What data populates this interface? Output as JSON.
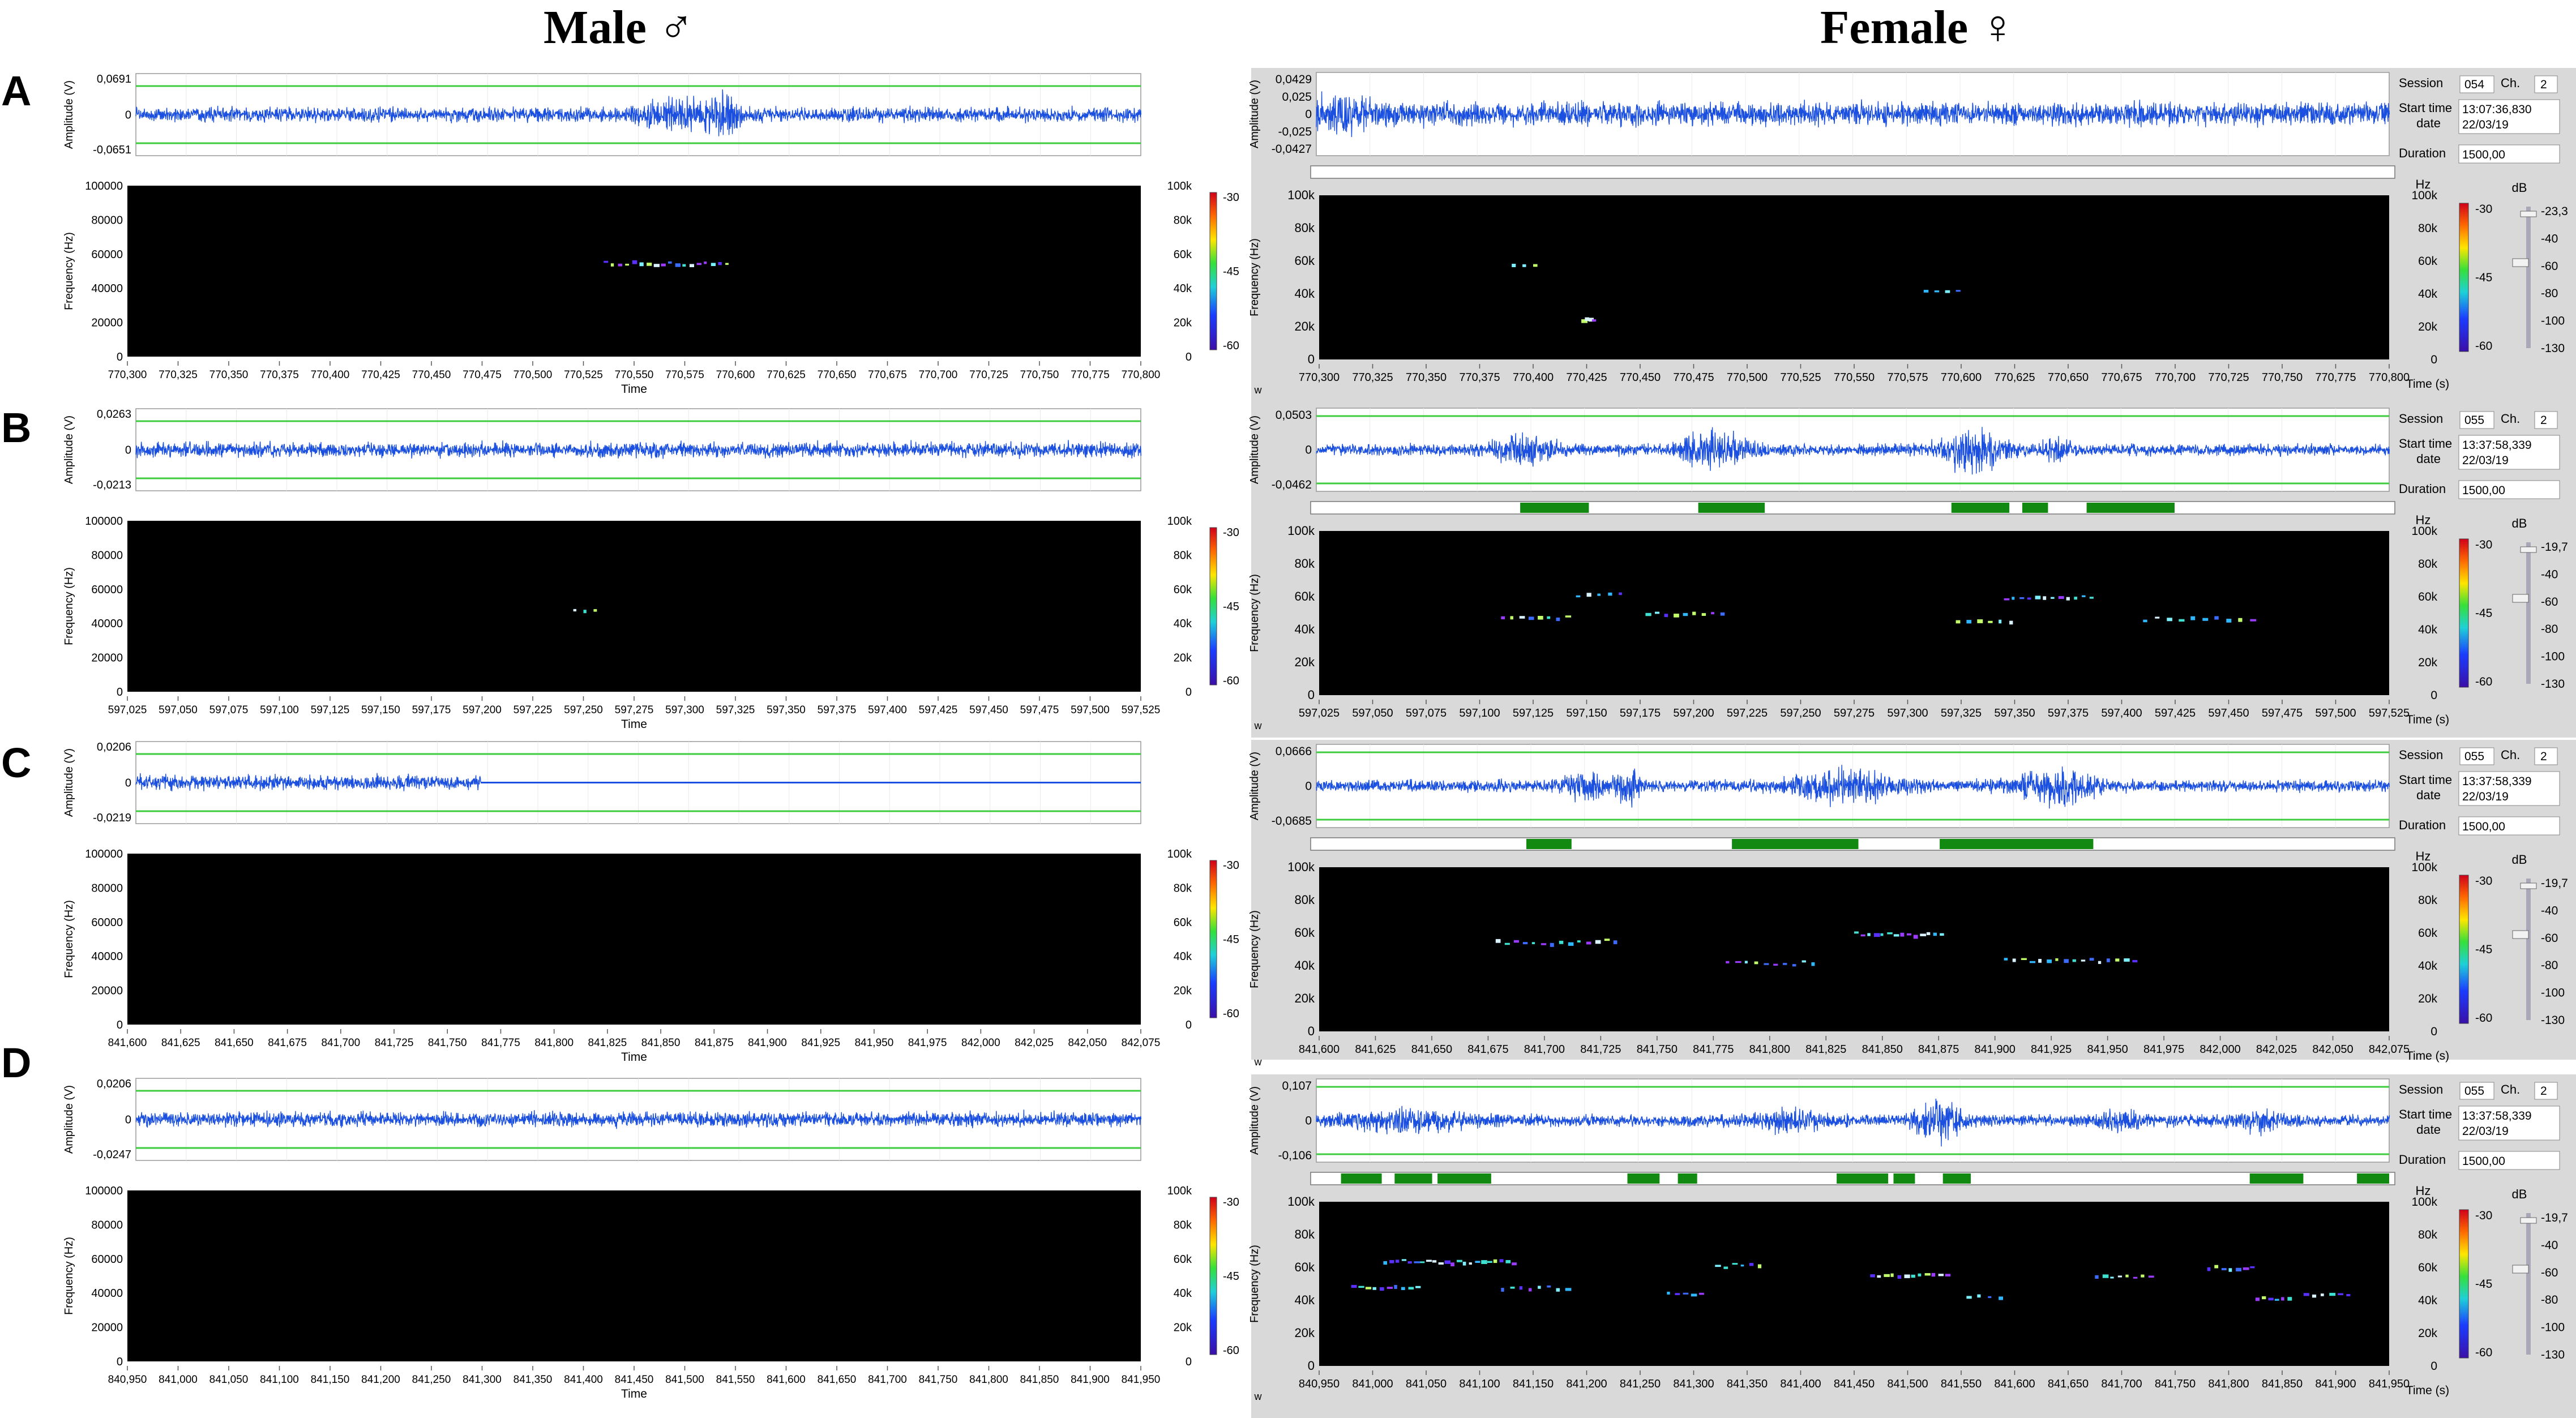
{
  "figure": {
    "col_titles": {
      "male": "Male ♂",
      "female": "Female ♀"
    }
  },
  "labels": {
    "amp_axis": "Amplitude (V)",
    "freq_axis": "Frequency (Hz)",
    "time_axis_male": "Time",
    "time_axis_female": "Time (s)",
    "session": "Session",
    "ch": "Ch.",
    "start_time": "Start time",
    "date": "date",
    "duration": "Duration",
    "hz": "Hz",
    "db": "dB",
    "w": "w"
  },
  "colors": {
    "waveform": "#1a4fe0",
    "threshold_line": "#3dcc3d",
    "detection_bar": "#128a12",
    "spectrogram_bg": "#000000",
    "panel_bg": "#d9d9d9"
  },
  "chart_data": [
    {
      "row": "A",
      "male": {
        "type": "waveform+spectrogram",
        "amp_ticks": [
          "0,0691",
          "0",
          "-0,0651"
        ],
        "freq_ticks": [
          "100000",
          "80000",
          "60000",
          "40000",
          "20000",
          "0"
        ],
        "cbar_freq_ticks": [
          "100k",
          "80k",
          "60k",
          "40k",
          "20k",
          "0"
        ],
        "cbar_db_ticks": [
          "-30",
          "-45",
          "-60"
        ],
        "time_ticks": [
          "770,300",
          "770,325",
          "770,350",
          "770,375",
          "770,400",
          "770,425",
          "770,450",
          "770,475",
          "770,500",
          "770,525",
          "770,550",
          "770,575",
          "770,600",
          "770,625",
          "770,650",
          "770,675",
          "770,700",
          "770,725",
          "770,750",
          "770,775",
          "770,800"
        ],
        "xlim": [
          770.3,
          770.8
        ]
      },
      "female": {
        "type": "waveform+spectrogram",
        "amp_ticks": [
          "0,0429",
          "0,025",
          "0",
          "-0,025",
          "-0,0427"
        ],
        "freq_ticks": [
          "100k",
          "80k",
          "60k",
          "40k",
          "20k",
          "0"
        ],
        "cbar_freq_ticks": [
          "100k",
          "80k",
          "60k",
          "40k",
          "20k",
          "0"
        ],
        "cbar_db_ticks": [
          "-30",
          "-45",
          "-60"
        ],
        "db_scale_ticks": [
          "-23,3",
          "-40",
          "-60",
          "-80",
          "-100",
          "-130"
        ],
        "time_ticks": [
          "770,300",
          "770,325",
          "770,350",
          "770,375",
          "770,400",
          "770,425",
          "770,450",
          "770,475",
          "770,500",
          "770,525",
          "770,550",
          "770,575",
          "770,600",
          "770,625",
          "770,650",
          "770,675",
          "770,700",
          "770,725",
          "770,750",
          "770,775",
          "770,800"
        ],
        "xlim": [
          770.3,
          770.8
        ],
        "session": "054",
        "channel": "2",
        "start_time": "13:07:36,830",
        "date": "22/03/19",
        "duration": "1500,00",
        "detections": []
      }
    },
    {
      "row": "B",
      "male": {
        "type": "waveform+spectrogram",
        "amp_ticks": [
          "0,0263",
          "0",
          "-0,0213"
        ],
        "freq_ticks": [
          "100000",
          "80000",
          "60000",
          "40000",
          "20000",
          "0"
        ],
        "cbar_freq_ticks": [
          "100k",
          "80k",
          "60k",
          "40k",
          "20k",
          "0"
        ],
        "cbar_db_ticks": [
          "-30",
          "-45",
          "-60"
        ],
        "time_ticks": [
          "597,025",
          "597,050",
          "597,075",
          "597,100",
          "597,125",
          "597,150",
          "597,175",
          "597,200",
          "597,225",
          "597,250",
          "597,275",
          "597,300",
          "597,325",
          "597,350",
          "597,375",
          "597,400",
          "597,425",
          "597,450",
          "597,475",
          "597,500",
          "597,525"
        ],
        "xlim": [
          597.025,
          597.525
        ]
      },
      "female": {
        "type": "waveform+spectrogram",
        "amp_ticks": [
          "0,0503",
          "0",
          "-0,0462"
        ],
        "freq_ticks": [
          "100k",
          "80k",
          "60k",
          "40k",
          "20k",
          "0"
        ],
        "cbar_freq_ticks": [
          "100k",
          "80k",
          "60k",
          "40k",
          "20k",
          "0"
        ],
        "cbar_db_ticks": [
          "-30",
          "-45",
          "-60"
        ],
        "db_scale_ticks": [
          "-19,7",
          "-40",
          "-60",
          "-80",
          "-100",
          "-130"
        ],
        "time_ticks": [
          "597,025",
          "597,050",
          "597,075",
          "597,100",
          "597,125",
          "597,150",
          "597,175",
          "597,200",
          "597,225",
          "597,250",
          "597,275",
          "597,300",
          "597,325",
          "597,350",
          "597,375",
          "597,400",
          "597,425",
          "597,450",
          "597,475",
          "597,500",
          "597,525"
        ],
        "xlim": [
          597.025,
          597.525
        ],
        "session": "055",
        "channel": "2",
        "start_time": "13:37:58,339",
        "date": "22/03/19",
        "duration": "1500,00",
        "detections": [
          [
            597.12,
            597.152
          ],
          [
            597.203,
            597.234
          ],
          [
            597.321,
            597.348
          ],
          [
            597.354,
            597.366
          ],
          [
            597.384,
            597.425
          ]
        ]
      }
    },
    {
      "row": "C",
      "male": {
        "type": "waveform+spectrogram",
        "amp_ticks": [
          "0,0206",
          "0",
          "-0,0219"
        ],
        "freq_ticks": [
          "100000",
          "80000",
          "60000",
          "40000",
          "20000",
          "0"
        ],
        "cbar_freq_ticks": [
          "100k",
          "80k",
          "60k",
          "40k",
          "20k",
          "0"
        ],
        "cbar_db_ticks": [
          "-30",
          "-45",
          "-60"
        ],
        "time_ticks": [
          "841,600",
          "841,625",
          "841,650",
          "841,675",
          "841,700",
          "841,725",
          "841,750",
          "841,775",
          "841,800",
          "841,825",
          "841,850",
          "841,875",
          "841,900",
          "841,925",
          "841,950",
          "841,975",
          "842,000",
          "842,025",
          "842,050",
          "842,075"
        ],
        "xlim": [
          841.6,
          842.075
        ],
        "signal_end": 841.763
      },
      "female": {
        "type": "waveform+spectrogram",
        "amp_ticks": [
          "0,0666",
          "0",
          "-0,0685"
        ],
        "freq_ticks": [
          "100k",
          "80k",
          "60k",
          "40k",
          "20k",
          "0"
        ],
        "cbar_freq_ticks": [
          "100k",
          "80k",
          "60k",
          "40k",
          "20k",
          "0"
        ],
        "cbar_db_ticks": [
          "-30",
          "-45",
          "-60"
        ],
        "db_scale_ticks": [
          "-19,7",
          "-40",
          "-60",
          "-80",
          "-100",
          "-130"
        ],
        "time_ticks": [
          "841,600",
          "841,625",
          "841,650",
          "841,675",
          "841,700",
          "841,725",
          "841,750",
          "841,775",
          "841,800",
          "841,825",
          "841,850",
          "841,875",
          "841,900",
          "841,925",
          "841,950",
          "841,975",
          "842,000",
          "842,025",
          "842,050",
          "842,075"
        ],
        "xlim": [
          841.6,
          842.075
        ],
        "session": "055",
        "channel": "2",
        "start_time": "13:37:58,339",
        "date": "22/03/19",
        "duration": "1500,00",
        "detections": [
          [
            841.693,
            841.713
          ],
          [
            841.784,
            841.84
          ],
          [
            841.876,
            841.944
          ]
        ]
      }
    },
    {
      "row": "D",
      "male": {
        "type": "waveform+spectrogram",
        "amp_ticks": [
          "0,0206",
          "0",
          "-0,0247"
        ],
        "freq_ticks": [
          "100000",
          "80000",
          "60000",
          "40000",
          "20000",
          "0"
        ],
        "cbar_freq_ticks": [
          "100k",
          "80k",
          "60k",
          "40k",
          "20k",
          "0"
        ],
        "cbar_db_ticks": [
          "-30",
          "-45",
          "-60"
        ],
        "time_ticks": [
          "840,950",
          "841,000",
          "841,050",
          "841,100",
          "841,150",
          "841,200",
          "841,250",
          "841,300",
          "841,350",
          "841,400",
          "841,450",
          "841,500",
          "841,550",
          "841,600",
          "841,650",
          "841,700",
          "841,750",
          "841,800",
          "841,850",
          "841,900",
          "841,950"
        ],
        "xlim": [
          840.95,
          841.95
        ]
      },
      "female": {
        "type": "waveform+spectrogram",
        "amp_ticks": [
          "0,107",
          "0",
          "-0,106"
        ],
        "freq_ticks": [
          "100k",
          "80k",
          "60k",
          "40k",
          "20k",
          "0"
        ],
        "cbar_freq_ticks": [
          "100k",
          "80k",
          "60k",
          "40k",
          "20k",
          "0"
        ],
        "cbar_db_ticks": [
          "-30",
          "-45",
          "-60"
        ],
        "db_scale_ticks": [
          "-19,7",
          "-40",
          "-60",
          "-80",
          "-100",
          "-130"
        ],
        "time_ticks": [
          "840,950",
          "841,000",
          "841,050",
          "841,100",
          "841,150",
          "841,200",
          "841,250",
          "841,300",
          "841,350",
          "841,400",
          "841,450",
          "841,500",
          "841,550",
          "841,600",
          "841,650",
          "841,700",
          "841,750",
          "841,800",
          "841,850",
          "841,900",
          "841,950"
        ],
        "xlim": [
          840.95,
          841.95
        ],
        "session": "055",
        "channel": "2",
        "start_time": "13:37:58,339",
        "date": "22/03/19",
        "duration": "1500,00",
        "detections": [
          [
            840.973,
            841.011
          ],
          [
            841.023,
            841.058
          ],
          [
            841.063,
            841.113
          ],
          [
            841.24,
            841.27
          ],
          [
            841.287,
            841.305
          ],
          [
            841.435,
            841.483
          ],
          [
            841.488,
            841.508
          ],
          [
            841.534,
            841.56
          ],
          [
            841.82,
            841.87
          ],
          [
            841.92,
            841.95
          ]
        ]
      }
    }
  ]
}
